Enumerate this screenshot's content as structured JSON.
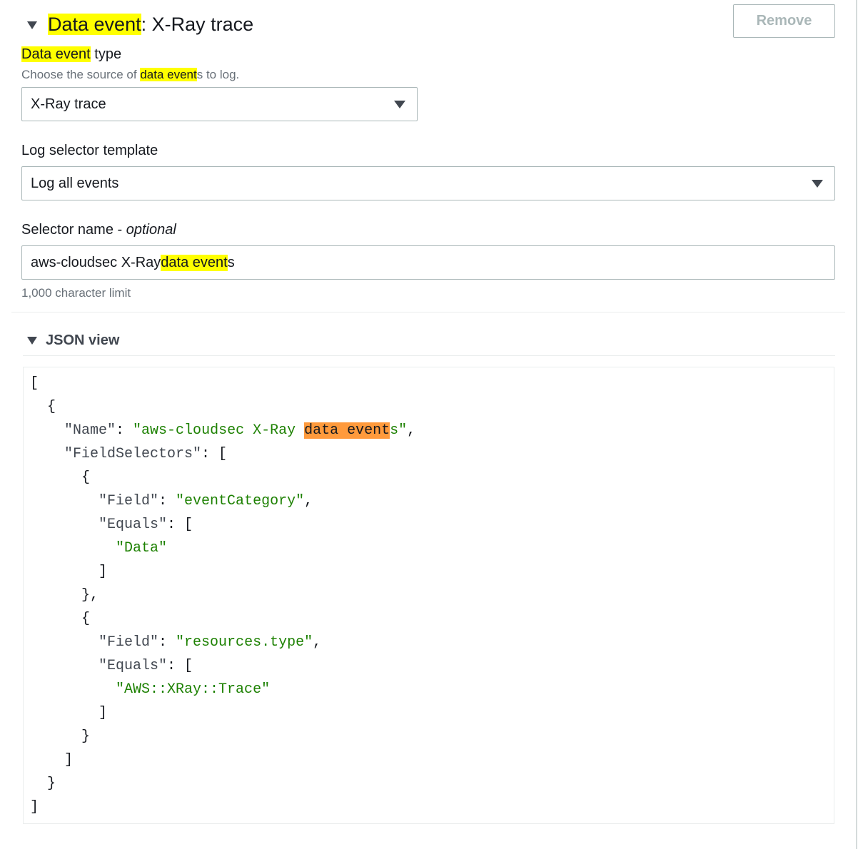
{
  "header": {
    "title_highlight": "Data event",
    "title_rest": ": X-Ray trace",
    "remove_label": "Remove"
  },
  "data_event_type": {
    "label_highlight": "Data event",
    "label_rest": " type",
    "description_before": "Choose the source of ",
    "description_highlight": "data event",
    "description_after": "s to log.",
    "selected_value": "X-Ray trace"
  },
  "log_selector_template": {
    "label": "Log selector template",
    "selected_value": "Log all events"
  },
  "selector_name": {
    "label": "Selector name - ",
    "label_optional": "optional",
    "value_before": "aws-cloudsec X-Ray ",
    "value_highlight": "data event",
    "value_after": "s",
    "constraint": "1,000 character limit"
  },
  "json_view": {
    "title": "JSON view",
    "name_key": "\"Name\"",
    "name_value_before": "\"aws-cloudsec X-Ray ",
    "name_value_highlight": "data event",
    "name_value_after": "s\"",
    "field_selectors_key": "\"FieldSelectors\"",
    "selectors": [
      {
        "field_key": "\"Field\"",
        "field_value": "\"eventCategory\"",
        "equals_key": "\"Equals\"",
        "equals_value": "\"Data\""
      },
      {
        "field_key": "\"Field\"",
        "field_value": "\"resources.type\"",
        "equals_key": "\"Equals\"",
        "equals_value": "\"AWS::XRay::Trace\""
      }
    ]
  },
  "colors": {
    "highlight": "#ffff00",
    "highlight_active": "#ff9a3c",
    "json_string": "#1d8102",
    "border": "#aab7b8"
  }
}
